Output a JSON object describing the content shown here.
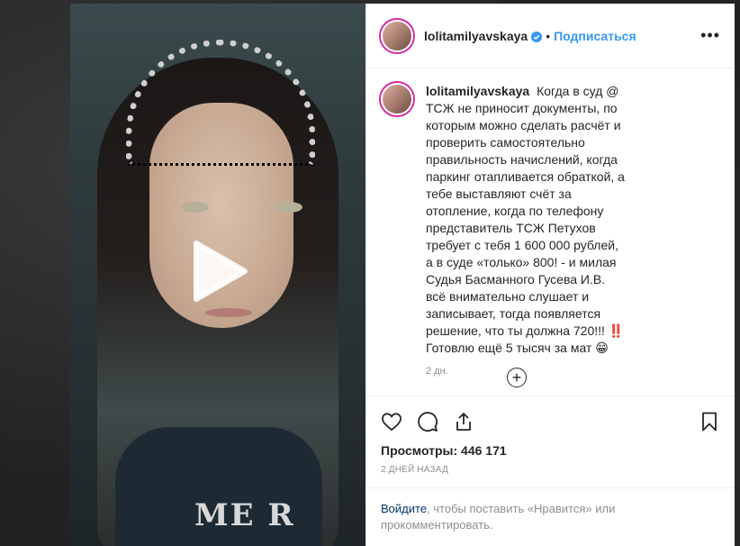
{
  "post": {
    "author": "lolitamilyavskaya",
    "follow_label": "Подписаться",
    "separator": "•",
    "more_label": "•••",
    "caption": "Когда в суд @ ТСЖ не приносит документы, по которым можно сделать расчёт и проверить самостоятельно правильность начислений, когда паркинг отапливается обраткой, а тебе выставляют счёт за отопление, когда по телефону представитель ТСЖ Петухов требует с тебя 1 600 000 рублей, а в суде «только» 800! - и милая Судья Басманного Гусева И.В. всё внимательно слушает и записывает, тогда появляется решение, что ты должна 720!!! ‼️ Готовлю ещё 5 тысяч за мат 😁",
    "caption_time": "2 дн.",
    "load_more": "+",
    "views_label": "Просмотры: 446 171",
    "date_label": "2 дней назад",
    "login_link": "Войдите",
    "login_rest": ", чтобы поставить «Нравится» или прокомментировать.",
    "shirt_text": "ME R"
  },
  "icons": {
    "verified": "verified-badge-icon",
    "play": "play-icon",
    "like": "heart-icon",
    "comment": "comment-icon",
    "share": "share-icon",
    "save": "bookmark-icon",
    "load_more": "plus-circle-icon"
  },
  "colors": {
    "accent": "#3897f0",
    "text": "#262626",
    "muted": "#8e8e8e",
    "link": "#003569"
  }
}
